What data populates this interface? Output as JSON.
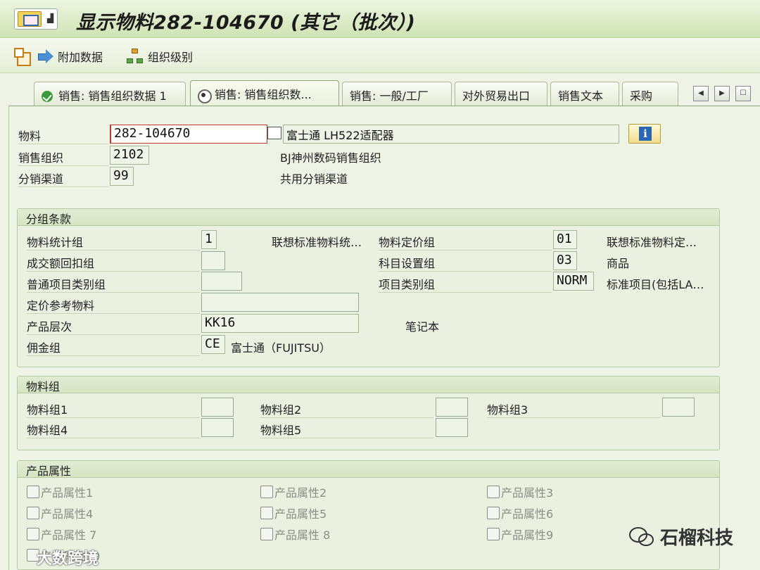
{
  "window": {
    "title": "显示物料282-104670 (其它（批次）)"
  },
  "toolbar": {
    "additional_data": "附加数据",
    "org_levels": "组织级别"
  },
  "tabs": [
    "销售: 销售组织数据 1",
    "销售: 销售组织数...",
    "销售: 一般/工厂",
    "对外贸易出口",
    "销售文本",
    "采购"
  ],
  "header": {
    "material_label": "物料",
    "material_value": "282-104670",
    "material_desc": "富士通 LH522适配器",
    "sales_org_label": "销售组织",
    "sales_org_value": "2102",
    "sales_org_desc": "BJ神州数码销售组织",
    "dist_channel_label": "分销渠道",
    "dist_channel_value": "99",
    "dist_channel_desc": "共用分销渠道"
  },
  "grouping": {
    "title": "分组条款",
    "mat_stat_group_label": "物料统计组",
    "mat_stat_group_value": "1",
    "mat_stat_group_desc": "联想标准物料统…",
    "mat_price_group_label": "物料定价组",
    "mat_price_group_value": "01",
    "mat_price_group_desc": "联想标准物料定…",
    "rebate_group_label": "成交额回扣组",
    "rebate_group_value": "",
    "acct_assign_group_label": "科目设置组",
    "acct_assign_group_value": "03",
    "acct_assign_group_desc": "商品",
    "gen_item_cat_label": "普通项目类别组",
    "gen_item_cat_value": "",
    "item_cat_group_label": "项目类别组",
    "item_cat_group_value": "NORM",
    "item_cat_group_desc": "标准项目(包括LA…",
    "pricing_ref_label": "定价参考物料",
    "pricing_ref_value": "",
    "prod_hier_label": "产品层次",
    "prod_hier_value": "KK16",
    "prod_hier_desc": "笔记本",
    "commission_label": "佣金组",
    "commission_value": "CE",
    "commission_desc": "富士通（FUJITSU）"
  },
  "material_groups": {
    "title": "物料组",
    "labels": [
      "物料组1",
      "物料组2",
      "物料组3",
      "物料组4",
      "物料组5"
    ]
  },
  "product_attributes": {
    "title": "产品属性",
    "labels": [
      "产品属性1",
      "产品属性2",
      "产品属性3",
      "产品属性4",
      "产品属性5",
      "产品属性6",
      "产品属性 7",
      "产品属性 8",
      "产品属性9",
      "产品属性10"
    ]
  },
  "watermarks": {
    "right": "石榴科技",
    "left": "大数跨境"
  }
}
